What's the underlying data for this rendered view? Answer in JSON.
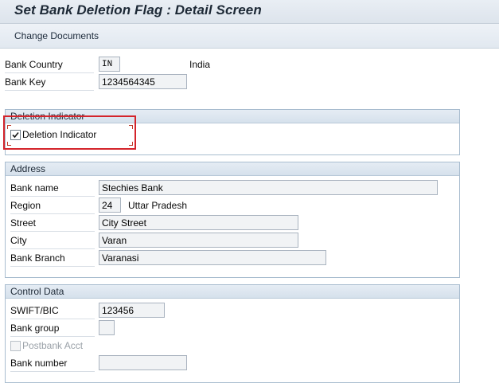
{
  "window": {
    "title": "Set Bank Deletion Flag : Detail Screen"
  },
  "toolbar": {
    "change_documents": "Change Documents"
  },
  "header": {
    "bank_country_label": "Bank Country",
    "bank_country_value": "IN",
    "bank_country_name": "India",
    "bank_key_label": "Bank Key",
    "bank_key_value": "1234564345"
  },
  "deletion_group": {
    "title": "Deletion Indicator",
    "checkbox_label": "Deletion Indicator",
    "checked": true
  },
  "address_group": {
    "title": "Address",
    "bank_name_label": "Bank name",
    "bank_name_value": "Stechies Bank",
    "region_label": "Region",
    "region_code": "24",
    "region_name": "Uttar Pradesh",
    "street_label": "Street",
    "street_value": "City Street",
    "city_label": "City",
    "city_value": "Varan",
    "branch_label": "Bank Branch",
    "branch_value": "Varanasi"
  },
  "control_group": {
    "title": "Control Data",
    "swift_label": "SWIFT/BIC",
    "swift_value": "123456",
    "bank_group_label": "Bank group",
    "bank_group_value": "",
    "postbank_label": "Postbank Acct",
    "postbank_checked": false,
    "bank_number_label": "Bank number",
    "bank_number_value": ""
  },
  "colors": {
    "highlight": "#d4242b",
    "group_border": "#a8bccf"
  }
}
